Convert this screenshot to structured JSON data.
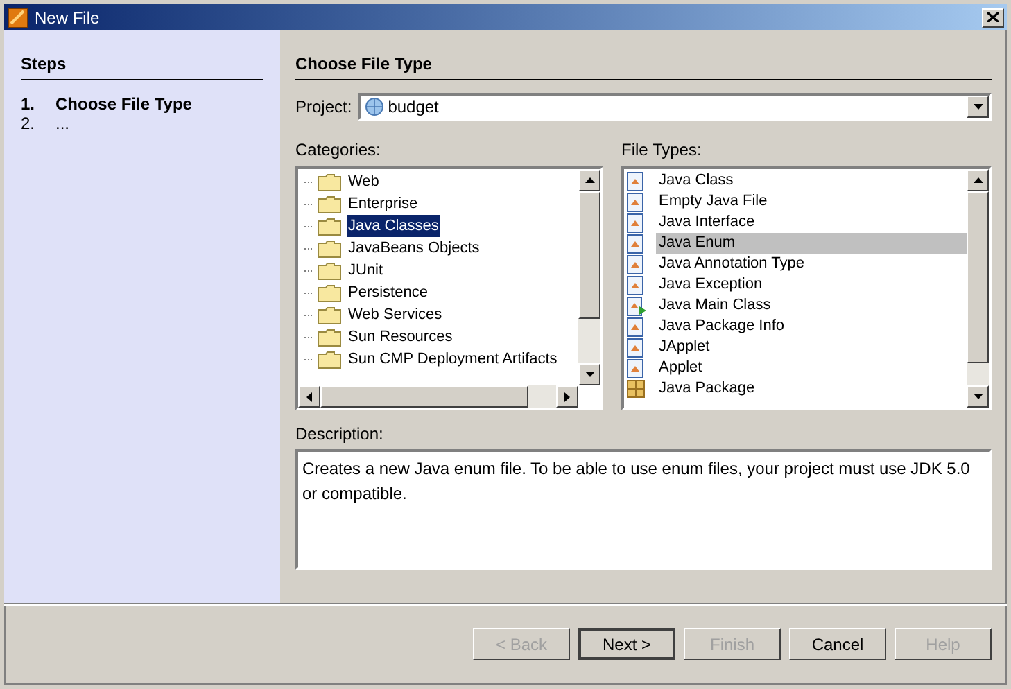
{
  "window": {
    "title": "New File"
  },
  "steps": {
    "title": "Steps",
    "items": [
      {
        "number": "1.",
        "label": "Choose File Type",
        "selected": true
      },
      {
        "number": "2.",
        "label": "...",
        "selected": false
      }
    ]
  },
  "panel": {
    "title": "Choose File Type"
  },
  "project": {
    "label": "Project:",
    "value": "budget"
  },
  "categories": {
    "label": "Categories:",
    "items": [
      {
        "label": "Web",
        "selected": false
      },
      {
        "label": "Enterprise",
        "selected": false
      },
      {
        "label": "Java Classes",
        "selected": true
      },
      {
        "label": "JavaBeans Objects",
        "selected": false
      },
      {
        "label": "JUnit",
        "selected": false
      },
      {
        "label": "Persistence",
        "selected": false
      },
      {
        "label": "Web Services",
        "selected": false
      },
      {
        "label": "Sun Resources",
        "selected": false
      },
      {
        "label": "Sun CMP Deployment Artifacts",
        "selected": false
      }
    ]
  },
  "file_types": {
    "label": "File Types:",
    "items": [
      {
        "label": "Java Class",
        "kind": "class",
        "selected": false
      },
      {
        "label": "Empty Java File",
        "kind": "class",
        "selected": false
      },
      {
        "label": "Java Interface",
        "kind": "class",
        "selected": false
      },
      {
        "label": "Java Enum",
        "kind": "class",
        "selected": true
      },
      {
        "label": "Java Annotation Type",
        "kind": "class",
        "selected": false
      },
      {
        "label": "Java Exception",
        "kind": "class",
        "selected": false
      },
      {
        "label": "Java Main Class",
        "kind": "main",
        "selected": false
      },
      {
        "label": "Java Package Info",
        "kind": "class",
        "selected": false
      },
      {
        "label": "JApplet",
        "kind": "class",
        "selected": false
      },
      {
        "label": "Applet",
        "kind": "class",
        "selected": false
      },
      {
        "label": "Java Package",
        "kind": "package",
        "selected": false
      }
    ]
  },
  "description": {
    "label": "Description:",
    "text": "Creates a new Java enum file. To be able to use enum files, your project must use JDK 5.0 or compatible."
  },
  "buttons": [
    {
      "label": "< Back",
      "disabled": true,
      "default": false
    },
    {
      "label": "Next >",
      "disabled": false,
      "default": true
    },
    {
      "label": "Finish",
      "disabled": true,
      "default": false
    },
    {
      "label": "Cancel",
      "disabled": false,
      "default": false
    },
    {
      "label": "Help",
      "disabled": true,
      "default": false
    }
  ]
}
